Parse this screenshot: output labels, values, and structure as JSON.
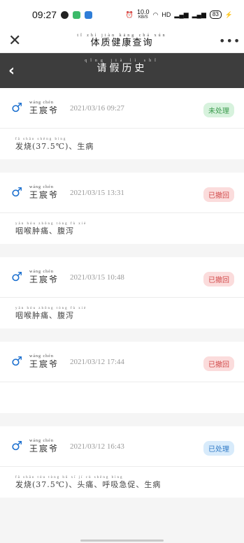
{
  "status_bar": {
    "time": "09:27",
    "speed_value": "10.0",
    "speed_unit": "KB/S",
    "network": "HD",
    "battery": "83"
  },
  "title_bar": {
    "title_pinyin": "tǐ zhì jiàn kāng chá xún",
    "title": "体质健康查询",
    "close": "✕",
    "more": "•••"
  },
  "header": {
    "pinyin": "qǐng jià lì shǐ",
    "title": "请假历史",
    "back": "‹"
  },
  "records": [
    {
      "name_pinyin": "wáng chén",
      "name": "王宸爷",
      "datetime": "2021/03/16 09:27",
      "status": "未处理",
      "status_color": "#3a9a4c",
      "symptom_pinyin": "fā shāo        shēng bìng",
      "symptom": "发烧(37.5℃)、生病"
    },
    {
      "name_pinyin": "wáng chén",
      "name": "王宸爷",
      "datetime": "2021/03/15 13:31",
      "status": "已撤回",
      "status_color": "#d24a4a",
      "symptom_pinyin": "yān hóu zhǒng tòng    fù xiè",
      "symptom": "咽喉肿痛、腹泻"
    },
    {
      "name_pinyin": "wáng chén",
      "name": "王宸爷",
      "datetime": "2021/03/15 10:48",
      "status": "已撤回",
      "status_color": "#d24a4a",
      "symptom_pinyin": "yān hóu zhǒng tòng    fù xiè",
      "symptom": "咽喉肿痛、腹泻"
    },
    {
      "name_pinyin": "wáng chén",
      "name": "王宸爷",
      "datetime": "2021/03/12 17:44",
      "status": "已撤回",
      "status_color": "#d24a4a",
      "symptom_pinyin": "",
      "symptom": ""
    },
    {
      "name_pinyin": "wáng chén",
      "name": "王宸爷",
      "datetime": "2021/03/12 16:43",
      "status": "已处理",
      "status_color": "#2f79c6",
      "symptom_pinyin": "fā shāo        tóu tòng   hū xī jí cù    shēng bìng",
      "symptom": "发烧(37.5℃)、头痛、呼吸急促、生病"
    }
  ]
}
